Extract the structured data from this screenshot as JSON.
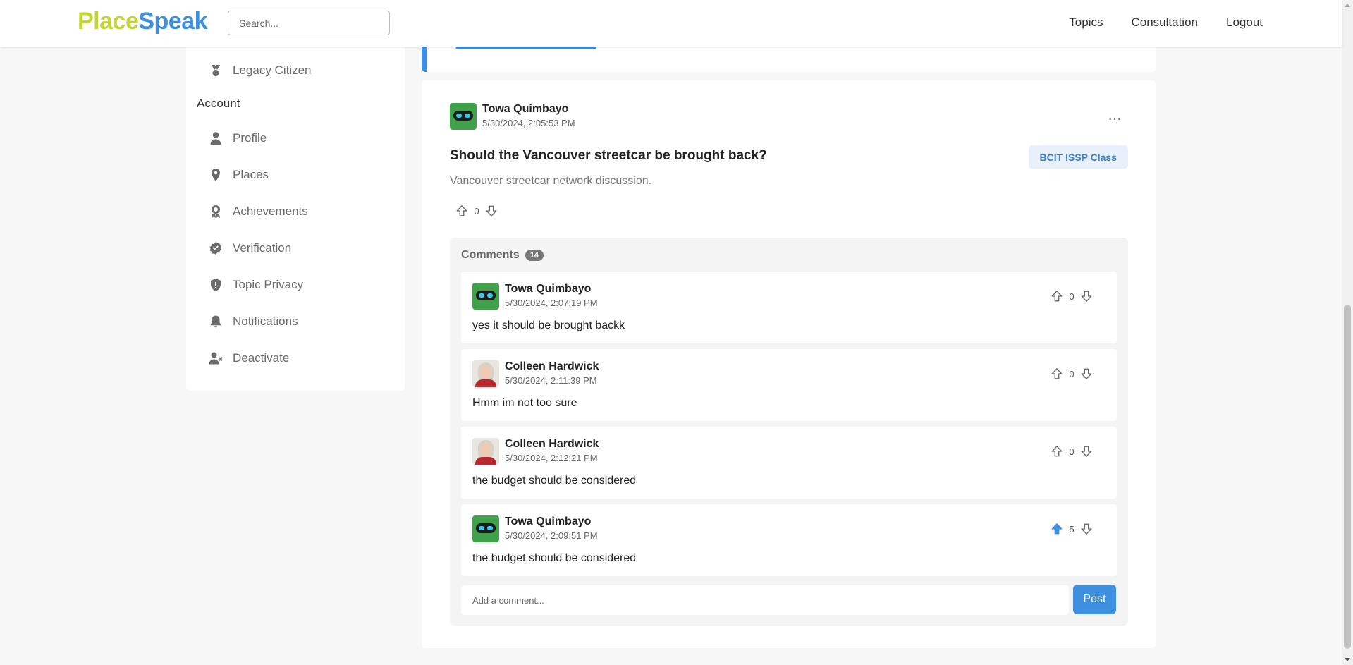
{
  "brand": {
    "part1": "Place",
    "part2": "Speak"
  },
  "search": {
    "placeholder": "Search..."
  },
  "nav": {
    "topics": "Topics",
    "consultation": "Consultation",
    "logout": "Logout"
  },
  "sidebar": {
    "legacy_item": "Legacy Citizen",
    "account_heading": "Account",
    "items": [
      {
        "label": "Profile",
        "icon": "person-icon"
      },
      {
        "label": "Places",
        "icon": "map-pin-icon"
      },
      {
        "label": "Achievements",
        "icon": "award-icon"
      },
      {
        "label": "Verification",
        "icon": "verified-badge-icon"
      },
      {
        "label": "Topic Privacy",
        "icon": "shield-icon"
      },
      {
        "label": "Notifications",
        "icon": "bell-icon"
      },
      {
        "label": "Deactivate",
        "icon": "user-remove-icon"
      }
    ]
  },
  "post": {
    "author": "Towa Quimbayo",
    "date": "5/30/2024, 2:05:53 PM",
    "title": "Should the Vancouver streetcar be brought back?",
    "tag": "BCIT ISSP Class",
    "description": "Vancouver streetcar network discussion.",
    "votes": "0",
    "more": "…"
  },
  "comments": {
    "label": "Comments",
    "count": "14",
    "items": [
      {
        "author": "Towa Quimbayo",
        "date": "5/30/2024, 2:07:19 PM",
        "text": "yes it should be brought backk",
        "votes": "0",
        "upvoted": false,
        "avatar": "robot"
      },
      {
        "author": "Colleen Hardwick",
        "date": "5/30/2024, 2:11:39 PM",
        "text": "Hmm im not too sure",
        "votes": "0",
        "upvoted": false,
        "avatar": "photo"
      },
      {
        "author": "Colleen Hardwick",
        "date": "5/30/2024, 2:12:21 PM",
        "text": "the budget should be considered",
        "votes": "0",
        "upvoted": false,
        "avatar": "photo"
      },
      {
        "author": "Towa Quimbayo",
        "date": "5/30/2024, 2:09:51 PM",
        "text": "the budget should be considered",
        "votes": "5",
        "upvoted": true,
        "avatar": "robot"
      }
    ],
    "add_placeholder": "Add a comment...",
    "post_button": "Post"
  },
  "colors": {
    "brand_green": "#c3d637",
    "brand_blue": "#3d8fe0",
    "upvote_active": "#3d8fe0"
  }
}
